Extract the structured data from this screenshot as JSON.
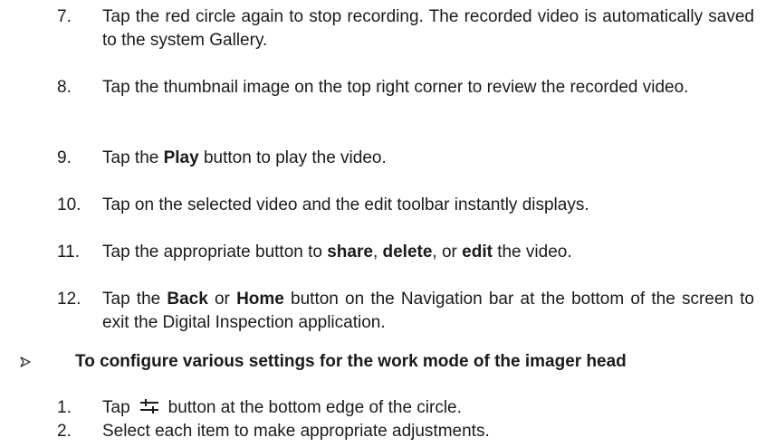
{
  "steps": [
    {
      "number": "7.",
      "parts": [
        {
          "text": "Tap the red circle again to stop recording. The recorded video is automatically saved to the system Gallery."
        }
      ]
    },
    {
      "number": "8.",
      "parts": [
        {
          "text": "Tap the thumbnail image on the top right corner to review the recorded video."
        }
      ]
    },
    {
      "number": "9.",
      "parts": [
        {
          "text": "Tap the "
        },
        {
          "text": "Play",
          "bold": true
        },
        {
          "text": " button to play the video."
        }
      ]
    },
    {
      "number": "10.",
      "parts": [
        {
          "text": "Tap on the selected video and the edit toolbar instantly displays."
        }
      ]
    },
    {
      "number": "11.",
      "parts": [
        {
          "text": "Tap the appropriate button to "
        },
        {
          "text": "share",
          "bold": true
        },
        {
          "text": ", "
        },
        {
          "text": "delete",
          "bold": true
        },
        {
          "text": ", or "
        },
        {
          "text": "edit",
          "bold": true
        },
        {
          "text": " the video."
        }
      ]
    },
    {
      "number": "12.",
      "parts": [
        {
          "text": "Tap the "
        },
        {
          "text": "Back",
          "bold": true
        },
        {
          "text": " or "
        },
        {
          "text": "Home",
          "bold": true
        },
        {
          "text": " button on the Navigation bar at the bottom of the screen to exit the Digital Inspection application."
        }
      ]
    }
  ],
  "section": {
    "bullet_icon": "arrowhead-bullet-icon",
    "heading": "To configure various settings for the work mode of the imager head",
    "substeps": [
      {
        "number": "1.",
        "before": "Tap",
        "icon": "settings-sliders-icon",
        "after": "button at the bottom edge of the circle."
      },
      {
        "number": "2.",
        "text": "Select each item to make appropriate adjustments."
      }
    ]
  }
}
